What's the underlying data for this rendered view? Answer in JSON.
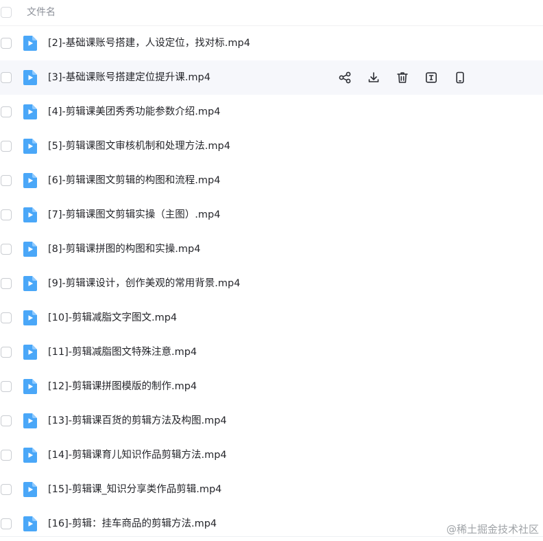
{
  "header": {
    "name_column": "文件名"
  },
  "files": [
    {
      "name": "[2]-基础课账号搭建，人设定位，找对标.mp4"
    },
    {
      "name": "[3]-基础课账号搭建定位提升课.mp4",
      "hover": true
    },
    {
      "name": "[4]-剪辑课美团秀秀功能参数介绍.mp4"
    },
    {
      "name": "[5]-剪辑课图文审核机制和处理方法.mp4"
    },
    {
      "name": "[6]-剪辑课图文剪辑的构图和流程.mp4"
    },
    {
      "name": "[7]-剪辑课图文剪辑实操（主图）.mp4"
    },
    {
      "name": "[8]-剪辑课拼图的构图和实操.mp4"
    },
    {
      "name": "[9]-剪辑课设计，创作美观的常用背景.mp4"
    },
    {
      "name": "[10]-剪辑减脂文字图文.mp4"
    },
    {
      "name": "[11]-剪辑减脂图文特殊注意.mp4"
    },
    {
      "name": "[12]-剪辑课拼图模版的制作.mp4"
    },
    {
      "name": "[13]-剪辑课百货的剪辑方法及构图.mp4"
    },
    {
      "name": "[14]-剪辑课育儿知识作品剪辑方法.mp4"
    },
    {
      "name": "[15]-剪辑课_知识分享类作品剪辑.mp4"
    },
    {
      "name": "[16]-剪辑：挂车商品的剪辑方法.mp4"
    }
  ],
  "row_actions": [
    "share-icon",
    "download-icon",
    "delete-icon",
    "rename-icon",
    "mobile-icon"
  ],
  "watermark": "@稀土掘金技术社区",
  "colors": {
    "file_icon": "#4aa7f8",
    "hover_row": "#f6f7fb",
    "action_icon": "#2b2d33"
  }
}
